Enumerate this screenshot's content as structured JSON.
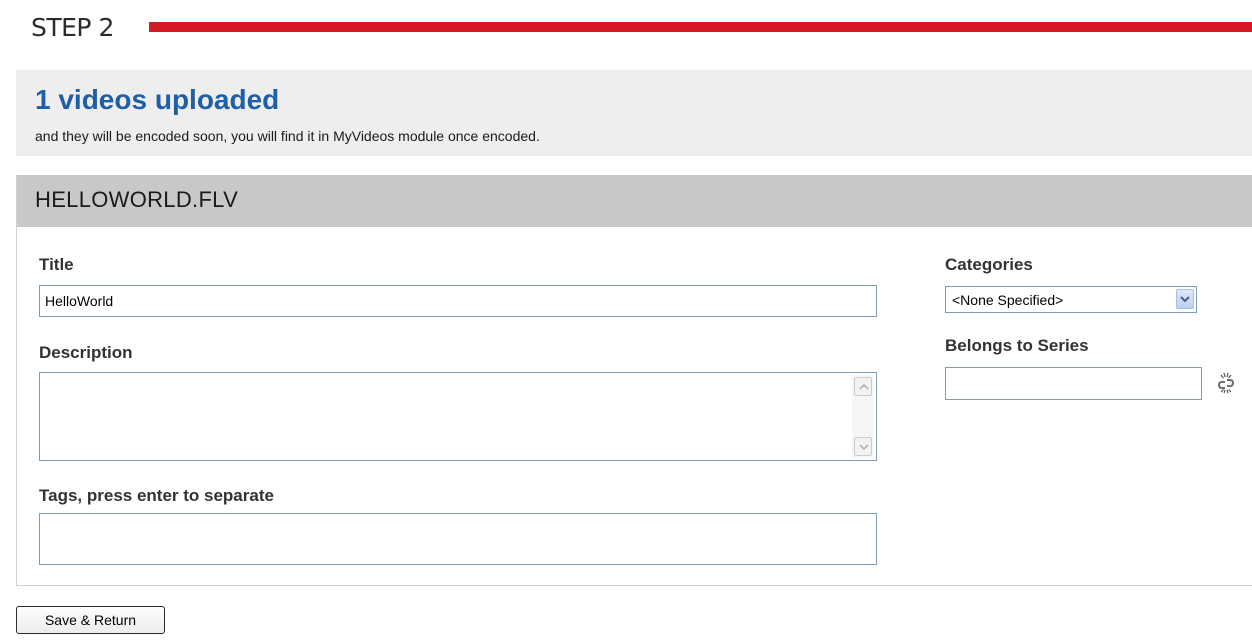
{
  "step": {
    "label": "STEP 2",
    "accent_color": "#d51a25"
  },
  "upload_summary": {
    "heading": "1 videos uploaded",
    "message": "and they will be encoded soon, you will find it in MyVideos module once encoded."
  },
  "file": {
    "name": "HELLOWORLD.FLV",
    "fields": {
      "title": {
        "label": "Title",
        "value": "HelloWorld"
      },
      "description": {
        "label": "Description",
        "value": ""
      },
      "tags": {
        "label": "Tags, press enter to separate",
        "value": ""
      },
      "categories": {
        "label": "Categories",
        "selected": "<None Specified>"
      },
      "series": {
        "label": "Belongs to Series",
        "value": "",
        "icon": "link-icon"
      }
    }
  },
  "actions": {
    "save_label": "Save & Return"
  }
}
